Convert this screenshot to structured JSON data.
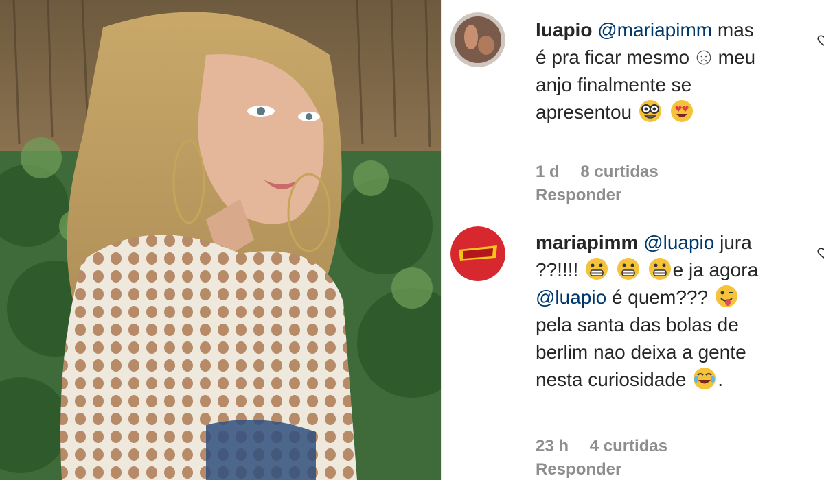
{
  "comments": [
    {
      "username": "luapio",
      "mention": "@mariapimm",
      "text_lines": [
        "mas",
        "é pra ficar mesmo",
        "meu",
        "anjo finalmente se",
        "apresentou"
      ],
      "time": "1 d",
      "likes": "8 curtidas",
      "reply": "Responder"
    },
    {
      "username": "mariapimm",
      "mention": "@luapio",
      "text_parts": [
        "jura",
        "??!!!!",
        "e ja agora",
        "@luapio",
        "é quem???",
        "pela santa das bolas de",
        "berlim nao deixa a gente",
        "nesta curiosidade",
        "."
      ],
      "time": "23 h",
      "likes": "4 curtidas",
      "reply": "Responder"
    }
  ]
}
